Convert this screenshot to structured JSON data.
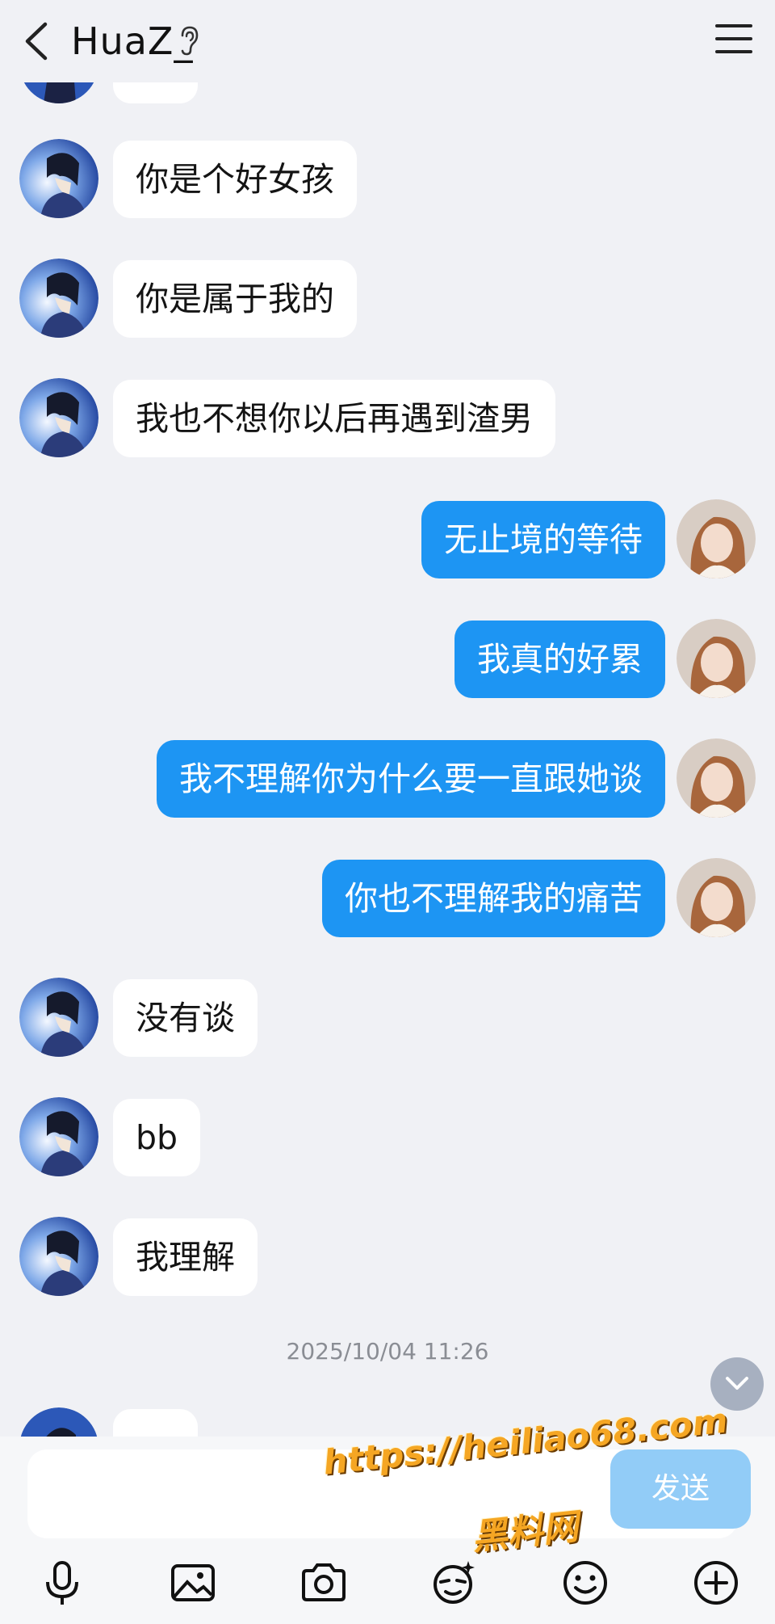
{
  "header": {
    "title": "HuaZ_"
  },
  "messages": [
    {
      "side": "left",
      "text": "你是个好女孩"
    },
    {
      "side": "left",
      "text": "你是属于我的"
    },
    {
      "side": "left",
      "text": "我也不想你以后再遇到渣男"
    },
    {
      "side": "right",
      "text": "无止境的等待"
    },
    {
      "side": "right",
      "text": "我真的好累"
    },
    {
      "side": "right",
      "text": "我不理解你为什么要一直跟她谈"
    },
    {
      "side": "right",
      "text": "你也不理解我的痛苦"
    },
    {
      "side": "left",
      "text": "没有谈"
    },
    {
      "side": "left",
      "text": "bb"
    },
    {
      "side": "left",
      "text": "我理解"
    }
  ],
  "timestamp": "2025/10/04 11:26",
  "input": {
    "placeholder": "",
    "send_label": "发送"
  },
  "toolbar": [
    "microphone-icon",
    "image-icon",
    "camera-icon",
    "sticker-icon",
    "emoji-icon",
    "plus-icon"
  ],
  "watermark": {
    "url": "https://heiliao68.com",
    "name": "黑料网"
  },
  "colors": {
    "background": "#f0f1f5",
    "self_bubble": "#1d95f3",
    "other_bubble": "#ffffff",
    "send_button": "#92ccf7"
  }
}
